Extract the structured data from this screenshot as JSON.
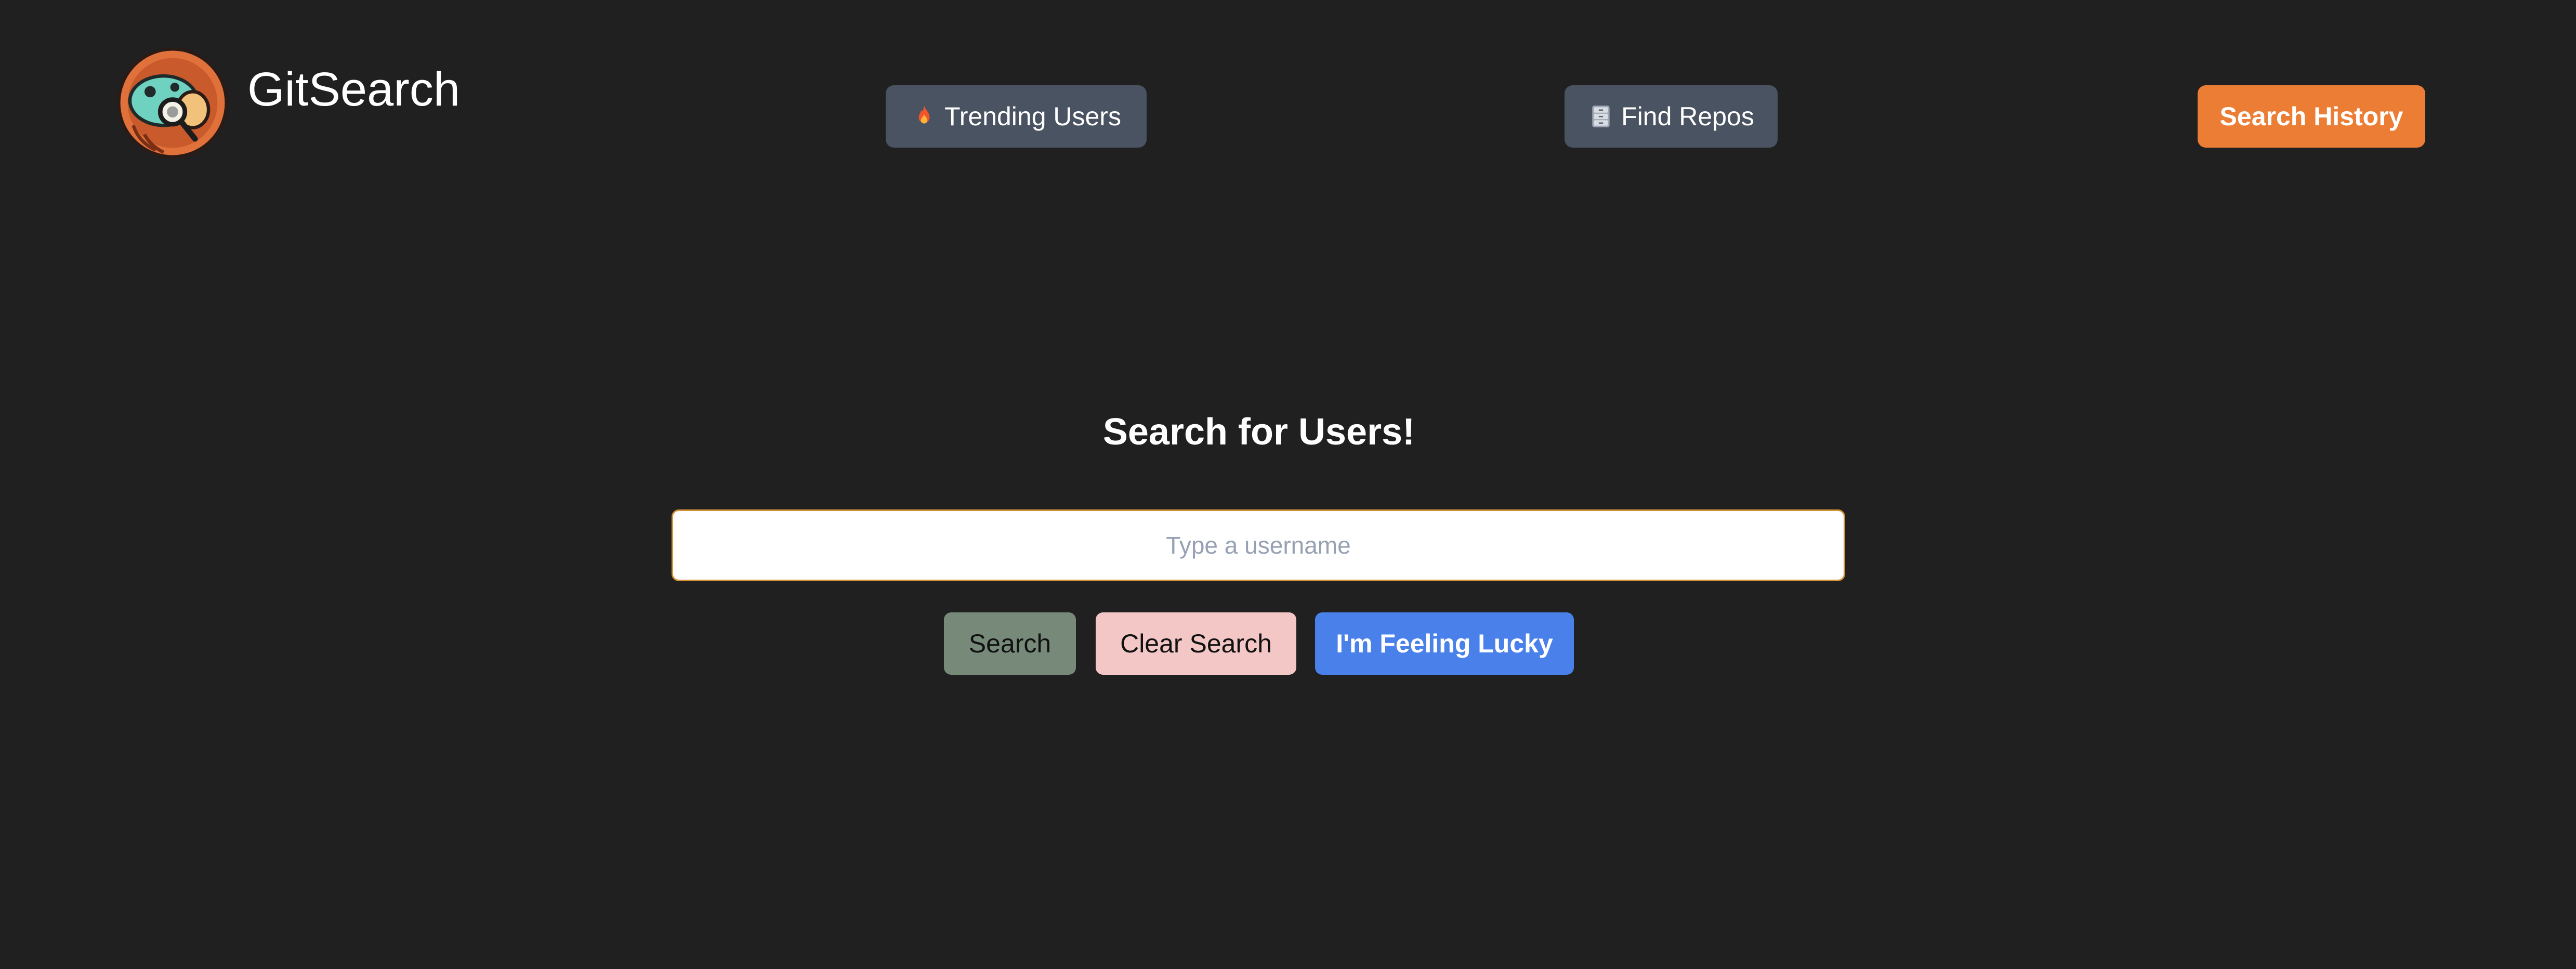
{
  "header": {
    "app_name": "GitSearch",
    "logo_icon": "magnifier-creature-logo-icon",
    "nav": {
      "trending": {
        "label": "Trending Users",
        "icon": "fire-icon"
      },
      "repos": {
        "label": "Find Repos",
        "icon": "filing-cabinet-icon"
      },
      "history": {
        "label": "Search History"
      }
    }
  },
  "main": {
    "title": "Search for Users!",
    "search": {
      "placeholder": "Type a username",
      "value": ""
    },
    "buttons": {
      "search": "Search",
      "clear": "Clear Search",
      "lucky": "I'm Feeling Lucky"
    }
  },
  "colors": {
    "background": "#202020",
    "nav_button": "#4a5361",
    "history_button": "#ec7d34",
    "search_button": "#778a7a",
    "clear_button": "#f4c7c7",
    "lucky_button": "#4a80ea",
    "input_border": "#d39237"
  }
}
